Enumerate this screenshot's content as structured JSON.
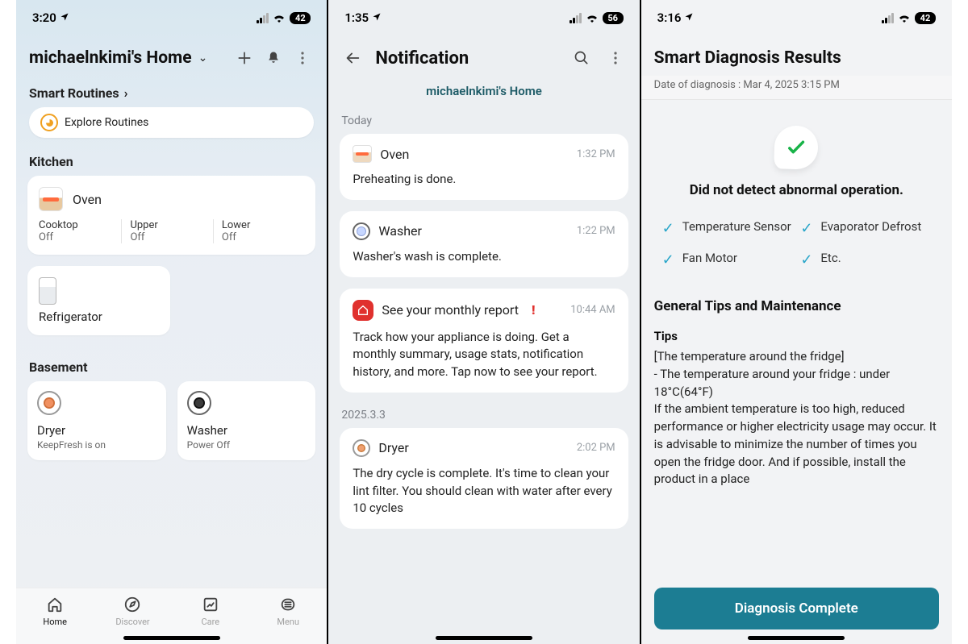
{
  "phone1": {
    "status": {
      "time": "3:20",
      "battery": "42"
    },
    "homeTitle": "michaelnkimi's Home",
    "routinesLabel": "Smart Routines",
    "exploreRoutines": "Explore Routines",
    "kitchenLabel": "Kitchen",
    "oven": {
      "name": "Oven",
      "cols": [
        {
          "label": "Cooktop",
          "state": "Off"
        },
        {
          "label": "Upper",
          "state": "Off"
        },
        {
          "label": "Lower",
          "state": "Off"
        }
      ]
    },
    "refrigerator": "Refrigerator",
    "basementLabel": "Basement",
    "dryer": {
      "name": "Dryer",
      "sub": "KeepFresh is on"
    },
    "washer": {
      "name": "Washer",
      "sub": "Power Off"
    },
    "nav": {
      "home": "Home",
      "discover": "Discover",
      "care": "Care",
      "menu": "Menu"
    }
  },
  "phone2": {
    "status": {
      "time": "1:35",
      "battery": "56"
    },
    "title": "Notification",
    "subheader": "michaelnkimi's Home",
    "todayLabel": "Today",
    "notifs": {
      "oven": {
        "title": "Oven",
        "time": "1:32 PM",
        "body": "Preheating is done."
      },
      "washer": {
        "title": "Washer",
        "time": "1:22 PM",
        "body": "Washer's wash is complete."
      },
      "report": {
        "title": "See your monthly report",
        "time": "10:44 AM",
        "body": "Track how your appliance is doing. Get a monthly summary, usage stats, notification history, and more. Tap now to see your report."
      }
    },
    "pastLabel": "2025.3.3",
    "pastDryer": {
      "title": "Dryer",
      "time": "2:02 PM",
      "body": "The dry cycle is complete. It's time to clean your lint filter. You should clean with water after every 10 cycles"
    }
  },
  "phone3": {
    "status": {
      "time": "3:16",
      "battery": "42"
    },
    "title": "Smart Diagnosis Results",
    "meta": "Date of diagnosis : Mar 4, 2025 3:15 PM",
    "okText": "Did not detect abnormal operation.",
    "checks": {
      "c1": "Temperature Sensor",
      "c2": "Evaporator Defrost",
      "c3": "Fan Motor",
      "c4": "Etc."
    },
    "tipsHeader": "General Tips and Maintenance",
    "tipsSub": "Tips",
    "tipsBody": "[The temperature around the fridge]\n - The temperature around your fridge : under 18°C(64°F)\nIf the ambient temperature is too high, reduced performance or higher electricity usage may occur. It is advisable to minimize the number of times you open the fridge door. And if possible, install the product in a place",
    "button": "Diagnosis Complete"
  }
}
